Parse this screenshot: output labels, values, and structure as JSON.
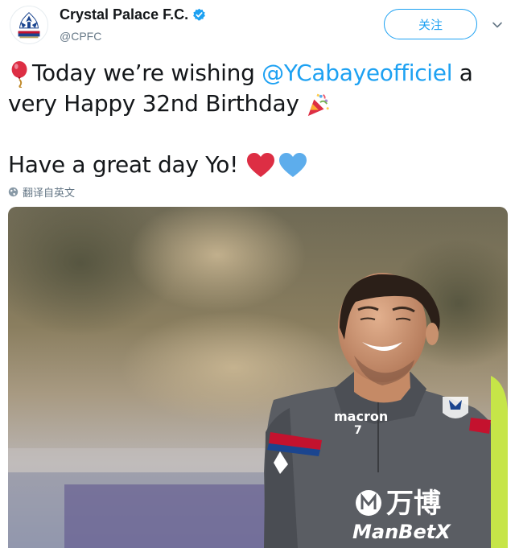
{
  "account": {
    "name": "Crystal Palace F.C.",
    "handle": "@CPFC",
    "follow_label": "关注"
  },
  "icons": {
    "verified": "verified-badge-icon",
    "caret": "chevron-down-icon",
    "globe": "globe-icon",
    "balloon": "balloon-emoji",
    "party": "party-popper-emoji",
    "red_heart": "red-heart-emoji",
    "blue_heart": "blue-heart-emoji"
  },
  "tweet": {
    "line1_prefix": "Today we’re wishing ",
    "mention": "@YCabayeofficiel",
    "line1_suffix": " a",
    "line2": "very Happy 32nd Birthday ",
    "line3": "Have a great day Yo! "
  },
  "translate_label": "翻译自英文",
  "media": {
    "shirt_brand": "macron",
    "shirt_number": "7",
    "sponsor_cn": "万博",
    "sponsor_en": "ManBetX"
  },
  "colors": {
    "accent": "#1da1f2",
    "text": "#14171a",
    "muted": "#657786",
    "heart_red": "#dd2e44",
    "heart_blue": "#5dadec"
  }
}
